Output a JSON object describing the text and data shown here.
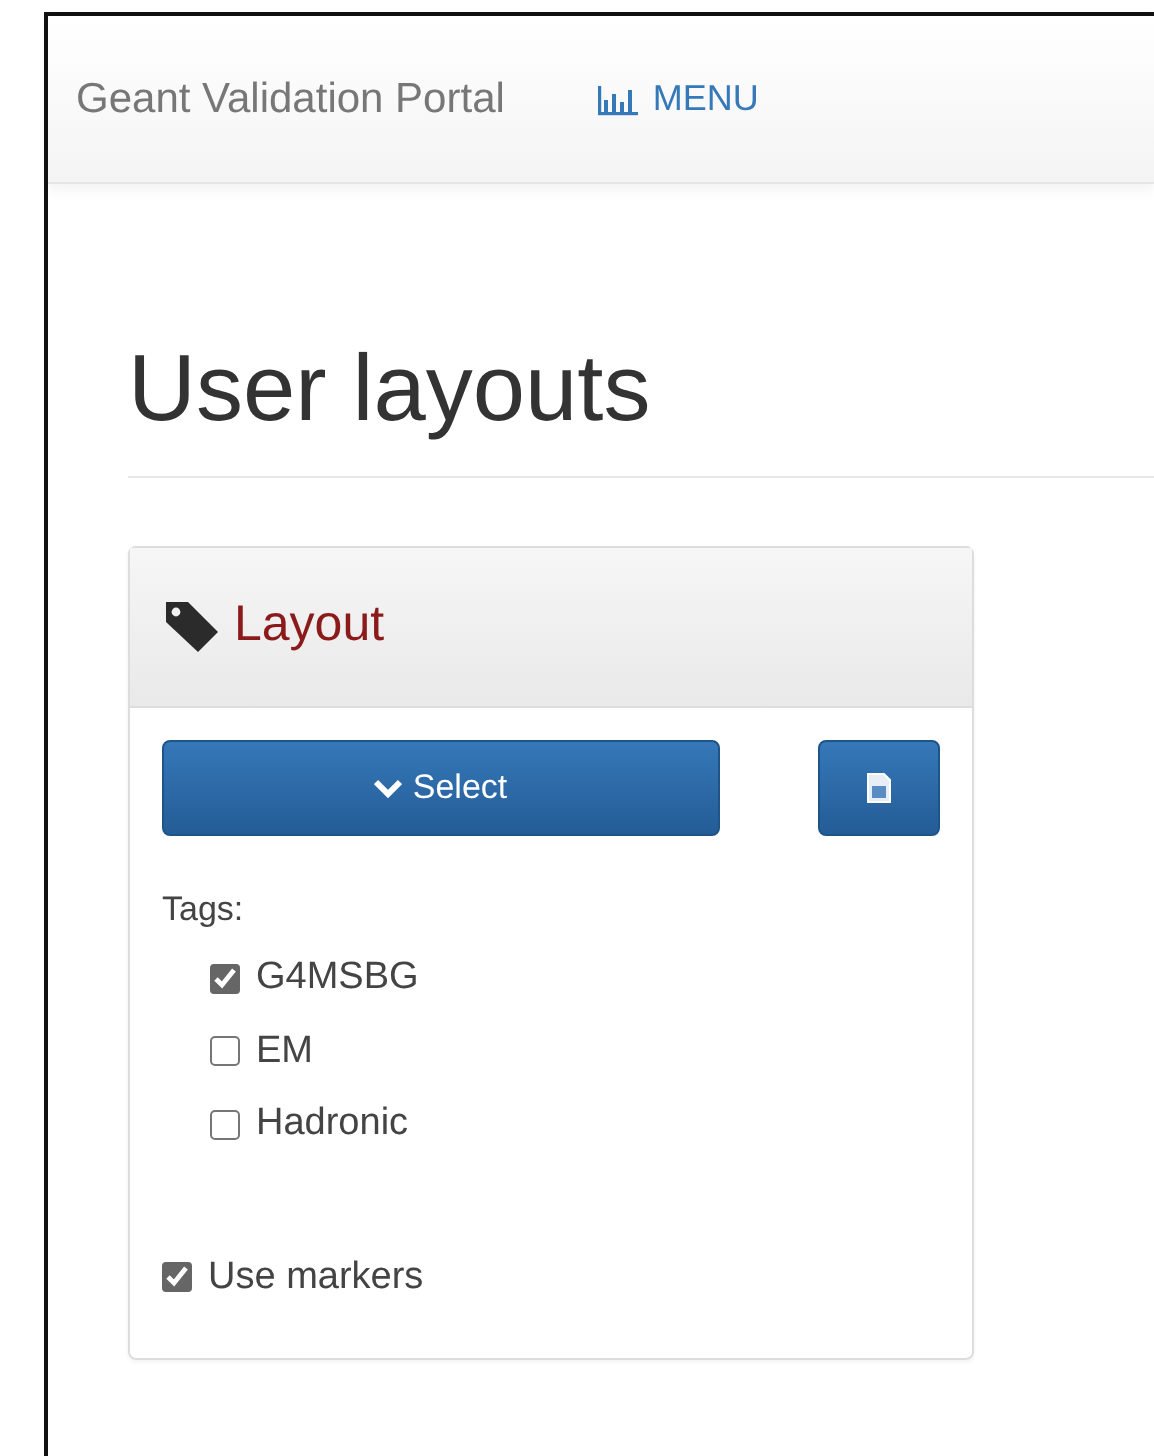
{
  "navbar": {
    "brand": "Geant Validation Portal",
    "menu": "MENU"
  },
  "page": {
    "heading": "User layouts"
  },
  "panel": {
    "title": "Layout",
    "select_button": "Select",
    "tags_label": "Tags:",
    "tags": [
      {
        "label": "G4MSBG",
        "checked": true
      },
      {
        "label": "EM",
        "checked": false
      },
      {
        "label": "Hadronic",
        "checked": false
      }
    ],
    "use_markers": {
      "label": "Use markers",
      "checked": true
    }
  }
}
